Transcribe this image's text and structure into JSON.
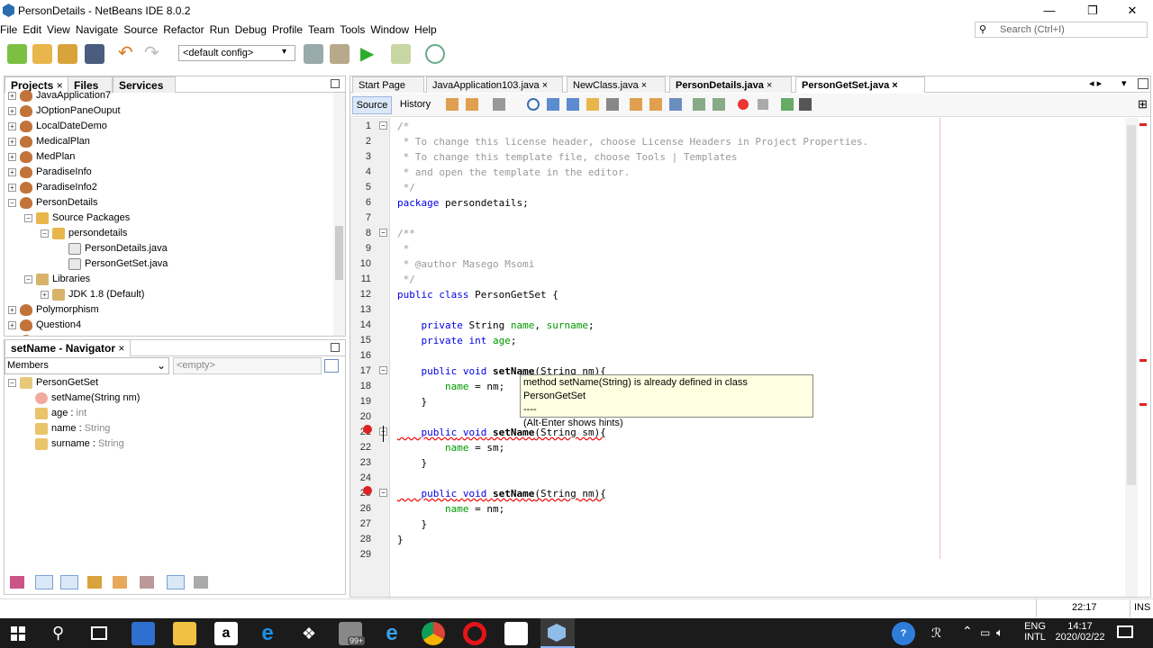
{
  "window": {
    "title": "PersonDetails - NetBeans IDE 8.0.2",
    "min": "—",
    "max": "❐",
    "close": "✕"
  },
  "menu": [
    "File",
    "Edit",
    "View",
    "Navigate",
    "Source",
    "Refactor",
    "Run",
    "Debug",
    "Profile",
    "Team",
    "Tools",
    "Window",
    "Help"
  ],
  "search": {
    "placeholder": "Search (Ctrl+I)"
  },
  "toolbar": {
    "config": "<default config>"
  },
  "projects_panel": {
    "tabs": [
      "Projects",
      "Files",
      "Services"
    ],
    "items": [
      {
        "label": "JavaApplication7",
        "level": 0,
        "type": "project"
      },
      {
        "label": "JOptionPaneOuput",
        "level": 0,
        "type": "project"
      },
      {
        "label": "LocalDateDemo",
        "level": 0,
        "type": "project"
      },
      {
        "label": "MedicalPlan",
        "level": 0,
        "type": "project"
      },
      {
        "label": "MedPlan",
        "level": 0,
        "type": "project"
      },
      {
        "label": "ParadiseInfo",
        "level": 0,
        "type": "project"
      },
      {
        "label": "ParadiseInfo2",
        "level": 0,
        "type": "project"
      },
      {
        "label": "PersonDetails",
        "level": 0,
        "type": "project"
      },
      {
        "label": "Source Packages",
        "level": 1,
        "type": "pkg"
      },
      {
        "label": "persondetails",
        "level": 2,
        "type": "pkg"
      },
      {
        "label": "PersonDetails.java",
        "level": 3,
        "type": "file"
      },
      {
        "label": "PersonGetSet.java",
        "level": 3,
        "type": "file"
      },
      {
        "label": "Libraries",
        "level": 1,
        "type": "lib"
      },
      {
        "label": "JDK 1.8 (Default)",
        "level": 2,
        "type": "lib"
      },
      {
        "label": "Polymorphism",
        "level": 0,
        "type": "project"
      },
      {
        "label": "Question4",
        "level": 0,
        "type": "project"
      },
      {
        "label": "Question42015",
        "level": 0,
        "type": "project"
      }
    ]
  },
  "navigator": {
    "title": "setName - Navigator",
    "filter": "Members",
    "empty": "<empty>",
    "root": "PersonGetSet",
    "members": [
      {
        "name": "setName(String nm)",
        "type": ""
      },
      {
        "name": "age : ",
        "type": "int"
      },
      {
        "name": "name : ",
        "type": "String"
      },
      {
        "name": "surname : ",
        "type": "String"
      }
    ]
  },
  "editor": {
    "tabs": [
      "Start Page",
      "JavaApplication103.java",
      "NewClass.java",
      "PersonDetails.java",
      "PersonGetSet.java"
    ],
    "modes": [
      "Source",
      "History"
    ],
    "tooltip": {
      "line1": "method setName(String) is already defined in class PersonGetSet",
      "line2": "----",
      "line3": "(Alt-Enter shows hints)"
    },
    "lines": [
      "/*",
      " * To change this license header, choose License Headers in Project Properties.",
      " * To change this template file, choose Tools | Templates",
      " * and open the template in the editor.",
      " */",
      "package persondetails;",
      "",
      "/**",
      " *",
      " * @author Masego Msomi",
      " */",
      "public class PersonGetSet {",
      "",
      "    private String name, surname;",
      "    private int age;",
      "",
      "    public void setName(String nm){",
      "        name = nm;",
      "    }",
      "",
      "    public void setName(String sm){",
      "        name = sm;",
      "    }",
      "",
      "    public void setName(String nm){",
      "        name = nm;",
      "    }",
      "}",
      ""
    ]
  },
  "status": {
    "position": "22:17",
    "mode": "INS"
  },
  "taskbar": {
    "lang1": "ENG",
    "lang2": "INTL",
    "time": "14:17",
    "date": "2020/02/22",
    "badge": "99+"
  }
}
